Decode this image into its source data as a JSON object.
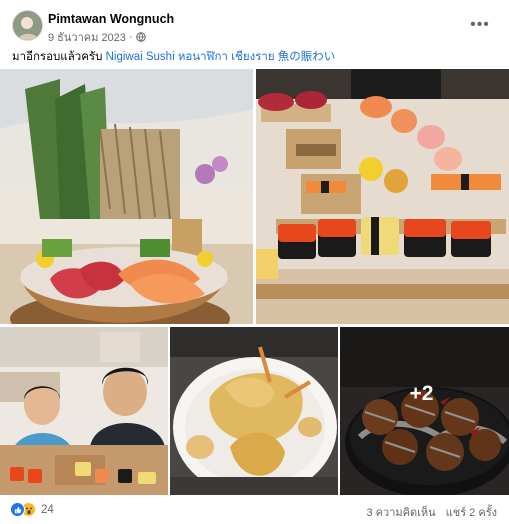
{
  "post": {
    "author": "Pimtawan Wongnuch",
    "date": "9 ธันวาคม 2023",
    "separator": "·",
    "caption_prefix": "มาอีกรอบแล้วครับ",
    "caption_link": "Nigiwai Sushi หอนาฬิกา เชียงราย 魚の賑わい",
    "more_photos": "+2",
    "reaction_count": "24",
    "comments": "3 ความคิดเห็น",
    "shares": "แชร์ 2 ครั้ง"
  },
  "colors": {
    "link": "#216fdb",
    "secondary_text": "#65676b",
    "like": "#1877f2",
    "wow": "#f7b928"
  },
  "icons": [
    "globe-icon",
    "more-options-icon",
    "like-reaction-icon",
    "wow-reaction-icon"
  ],
  "photos": [
    "sashimi-boat-photo",
    "sushi-platter-photo",
    "kids-at-restaurant-photo",
    "tempura-photo",
    "takoyaki-photo"
  ]
}
